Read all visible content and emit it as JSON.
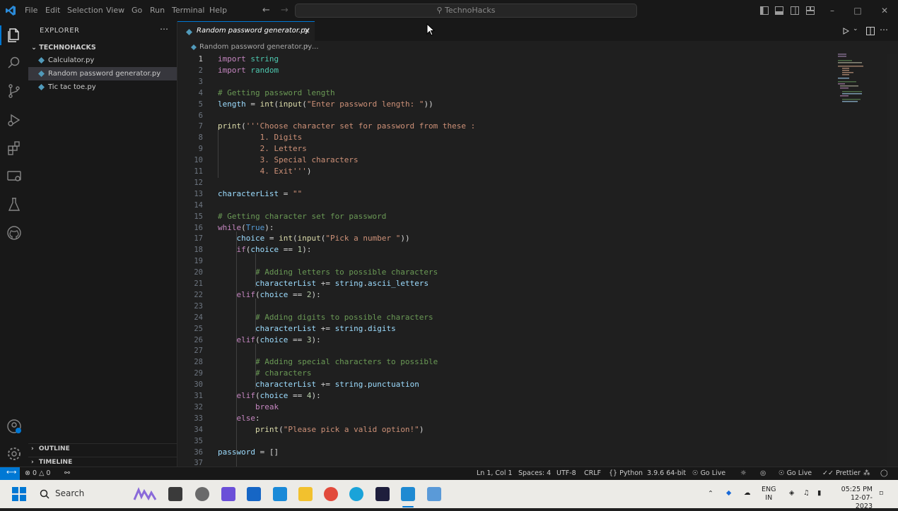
{
  "menu": [
    "File",
    "Edit",
    "Selection",
    "View",
    "Go",
    "Run",
    "Terminal",
    "Help"
  ],
  "search_label": "TechnoHacks",
  "explorer": {
    "title": "EXPLORER",
    "folder": "TECHNOHACKS",
    "files": [
      "Calculator.py",
      "Random password generator.py",
      "Tic tac toe.py"
    ],
    "sections": [
      "OUTLINE",
      "TIMELINE"
    ]
  },
  "tab": {
    "label": "Random password generator.py"
  },
  "breadcrumb": [
    "Random password generator.py",
    "..."
  ],
  "code_lines": [
    "import string",
    "import random",
    "",
    "# Getting password length",
    "length = int(input(\"Enter password length: \"))",
    "",
    "print('''Choose character set for password from these :",
    "         1. Digits",
    "         2. Letters",
    "         3. Special characters",
    "         4. Exit''')",
    "",
    "characterList = \"\"",
    "",
    "# Getting character set for password",
    "while(True):",
    "    choice = int(input(\"Pick a number \"))",
    "    if(choice == 1):",
    "",
    "        # Adding letters to possible characters",
    "        characterList += string.ascii_letters",
    "    elif(choice == 2):",
    "",
    "        # Adding digits to possible characters",
    "        characterList += string.digits",
    "    elif(choice == 3):",
    "",
    "        # Adding special characters to possible",
    "        # characters",
    "        characterList += string.punctuation",
    "    elif(choice == 4):",
    "        break",
    "    else:",
    "        print(\"Please pick a valid option!\")",
    "",
    "password = []",
    ""
  ],
  "status": {
    "problems": "0",
    "warnings": "0",
    "position": "Ln 1, Col 1",
    "spaces": "Spaces: 4",
    "encoding": "UTF-8",
    "eol": "CRLF",
    "language": "Python",
    "interpreter": "3.9.6 64-bit",
    "go_live": "Go Live",
    "go_live2": "Go Live",
    "prettier": "Prettier"
  },
  "taskbar": {
    "search": "Search",
    "lang1": "ENG",
    "lang2": "IN",
    "time": "05:25 PM",
    "date": "12-07-2023"
  },
  "colors": {
    "accent": "#0078d4",
    "python_icon": "#519aba"
  }
}
